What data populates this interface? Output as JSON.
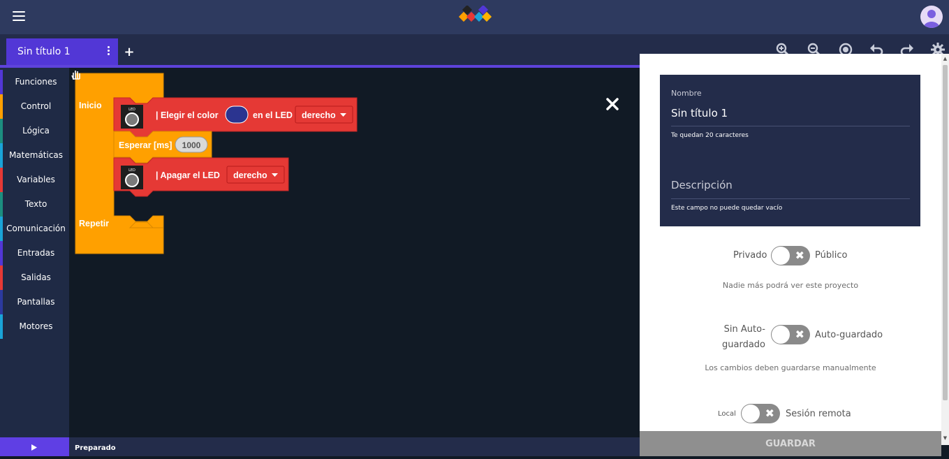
{
  "header": {
    "menu_icon": "hamburger-icon",
    "logo_icon": "app-logo",
    "avatar_icon": "user-avatar-icon"
  },
  "tabs": [
    {
      "label": "Sin título 1"
    }
  ],
  "toolbar": {
    "icons": [
      "zoom-in-icon",
      "zoom-out-icon",
      "target-center-icon",
      "undo-icon",
      "redo-icon",
      "settings-icon"
    ]
  },
  "sidebar": {
    "categories": [
      {
        "label": "Funciones",
        "color": "#5237d6"
      },
      {
        "label": "Control",
        "color": "#ffa000"
      },
      {
        "label": "Lógica",
        "color": "#1c8e7f"
      },
      {
        "label": "Matemáticas",
        "color": "#1aa4d8"
      },
      {
        "label": "Variables",
        "color": "#e53935"
      },
      {
        "label": "Texto",
        "color": "#1c8e7f"
      },
      {
        "label": "Comunicación",
        "color": "#1aa4d8"
      },
      {
        "label": "Entradas",
        "color": "#5237d6"
      },
      {
        "label": "Salidas",
        "color": "#e53935"
      },
      {
        "label": "Pantallas",
        "color": "#2c3a9e"
      },
      {
        "label": "Motores",
        "color": "#1aa4d8"
      }
    ]
  },
  "blocks": {
    "inicio": "Inicio",
    "repetir": "Repetir",
    "led1_text": "| Elegir el color",
    "led1_in": "en el LED",
    "led1_side": "derecho",
    "led1_color": "#2b3490",
    "wait_text": "Esperar [ms]",
    "wait_value": "1000",
    "led2_text": "| Apagar el LED",
    "led2_side": "derecho",
    "led_icon_caption": "LED"
  },
  "status": {
    "text": "Preparado"
  },
  "panel": {
    "name_label": "Nombre",
    "name_value": "Sin título 1",
    "name_hint": "Te quedan 20 caracteres",
    "desc_label": "Descripción",
    "desc_hint": "Este campo no puede quedar vacío",
    "privacy_left": "Privado",
    "privacy_right": "Público",
    "privacy_note": "Nadie más podrá ver este proyecto",
    "autosave_left_1": "Sin Auto-",
    "autosave_left_2": "guardado",
    "autosave_right": "Auto-guardado",
    "autosave_note": "Los cambios deben guardarse manualmente",
    "session_left": "Local",
    "session_right": "Sesión remota",
    "toggle_x": "✖",
    "save_label": "GUARDAR"
  },
  "colors": {
    "orange": "#ffa000",
    "red": "#e53935",
    "purple": "#5237d6"
  }
}
